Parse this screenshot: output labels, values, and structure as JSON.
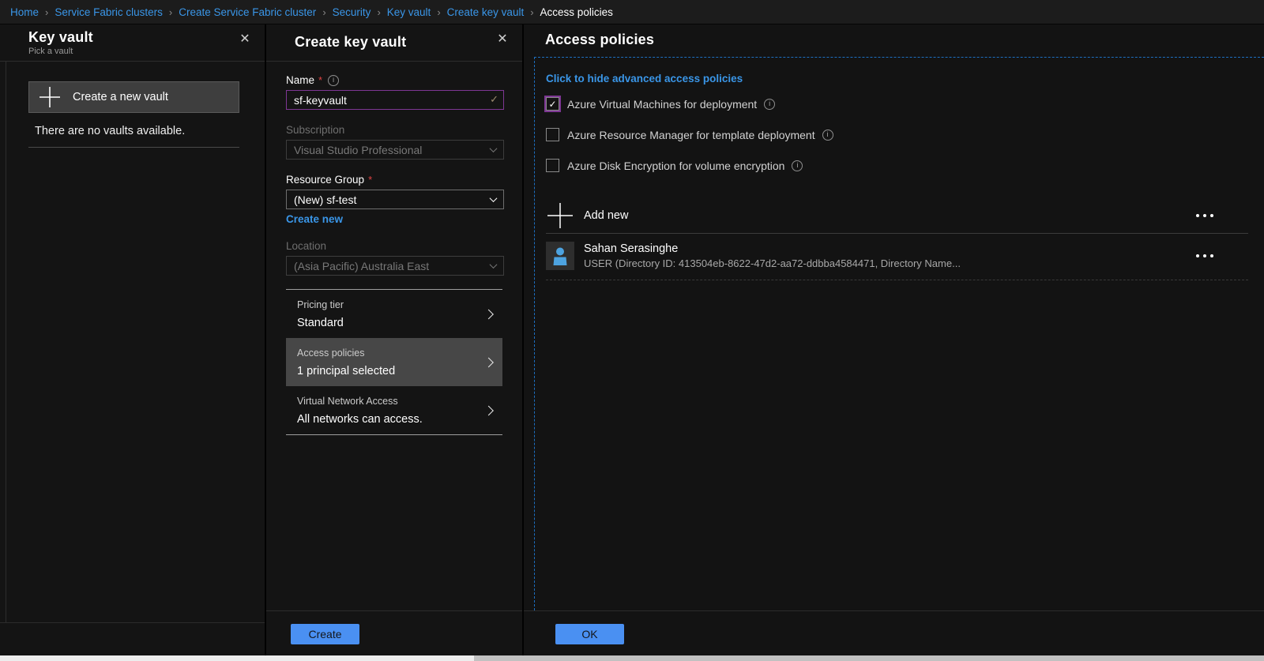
{
  "breadcrumb": {
    "separator": "›",
    "items": [
      "Home",
      "Service Fabric clusters",
      "Create Service Fabric cluster",
      "Security",
      "Key vault",
      "Create key vault"
    ],
    "current": "Access policies"
  },
  "icons": {
    "close": "✕",
    "check": "✓",
    "info": "i",
    "required_mark": "*"
  },
  "colors": {
    "link_blue": "#3a96e8",
    "button_blue": "#4a90f2",
    "input_border_purple": "#7e3794",
    "dashed_border_blue": "#1d6fc0",
    "required_red": "#e04343",
    "avatar_blue": "#4da3e0",
    "selected_item_bg": "#474747"
  },
  "left_panel": {
    "title": "Key vault",
    "subtitle": "Pick a vault",
    "create_button": "Create a new vault",
    "empty_text": "There are no vaults available."
  },
  "middle_panel": {
    "title": "Create key vault",
    "name_field": {
      "label": "Name",
      "value": "sf-keyvault"
    },
    "subscription_field": {
      "label": "Subscription",
      "value": "Visual Studio Professional"
    },
    "resource_group_field": {
      "label": "Resource Group",
      "value": "(New) sf-test",
      "link": "Create new"
    },
    "location_field": {
      "label": "Location",
      "value": "(Asia Pacific) Australia East"
    },
    "settings": [
      {
        "label": "Pricing tier",
        "value": "Standard"
      },
      {
        "label": "Access policies",
        "value": "1 principal selected"
      },
      {
        "label": "Virtual Network Access",
        "value": "All networks can access."
      }
    ],
    "create_button": "Create"
  },
  "right_panel": {
    "title": "Access policies",
    "toggle_link": "Click to hide advanced access policies",
    "checkboxes": [
      {
        "label": "Azure Virtual Machines for deployment",
        "checked": true
      },
      {
        "label": "Azure Resource Manager for template deployment",
        "checked": false
      },
      {
        "label": "Azure Disk Encryption for volume encryption",
        "checked": false
      }
    ],
    "add_new_label": "Add new",
    "principal": {
      "name": "Sahan Serasinghe",
      "detail": "USER (Directory ID: 413504eb-8622-47d2-aa72-ddbba4584471, Directory Name..."
    },
    "ok_button": "OK"
  }
}
